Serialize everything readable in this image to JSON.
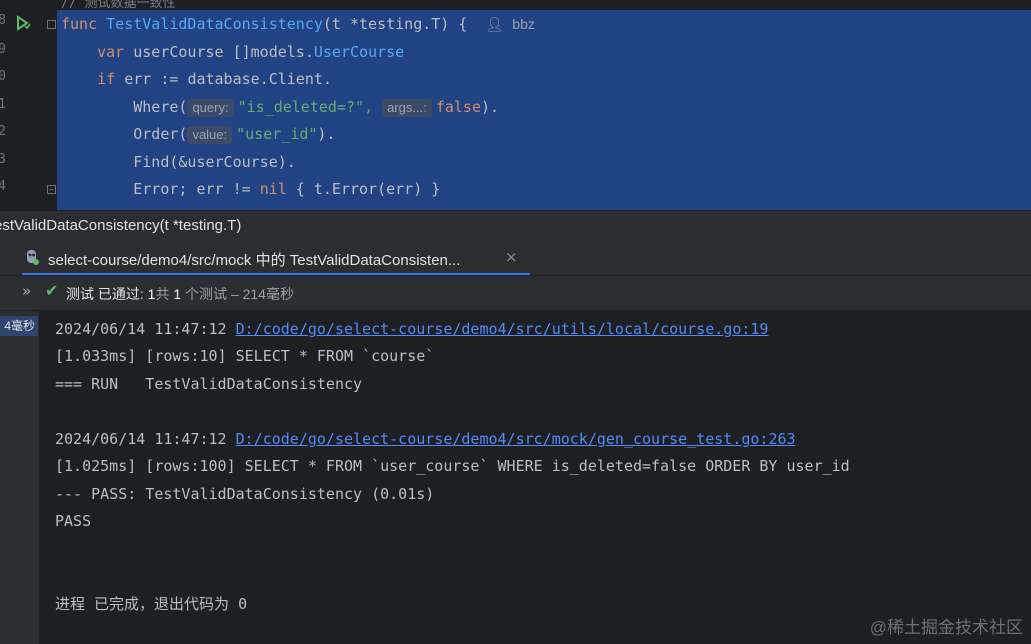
{
  "editor": {
    "comment": "// 测试数据一致性",
    "line_numbers": [
      "8",
      "9",
      "0",
      "1",
      "2",
      "3",
      "4"
    ],
    "lines": {
      "l1": {
        "kw": "func",
        "fn": "TestValidDataConsistency",
        "params": "(t *testing.T) {",
        "author_icon": "user-icon",
        "author": "bbz"
      },
      "l2": {
        "kw": "var",
        "name": "userCourse",
        "slice": "[]models.",
        "type": "UserCourse"
      },
      "l3": {
        "kw": "if",
        "expr": "err := ",
        "db": "database",
        "rest": ".Client."
      },
      "l4": {
        "method": "Where(",
        "hint1": "query:",
        "arg1": "\"is_deleted=?\",",
        "hint2": "args...:",
        "arg2": "false",
        "end": ")."
      },
      "l5": {
        "method": "Order(",
        "hint": "value:",
        "arg": "\"user_id\"",
        "end": ")."
      },
      "l6": {
        "text": "Find(&userCourse)."
      },
      "l7": {
        "text1": "Error; err != ",
        "kw": "nil",
        "text2": " { t.Error(err) }"
      }
    }
  },
  "breadcrumb": {
    "text": "estValidDataConsistency(t *testing.T)"
  },
  "run_tab": {
    "label": "select-course/demo4/src/mock 中的 TestValidDataConsisten...",
    "close": "×"
  },
  "status": {
    "expand": "»",
    "check": "✔",
    "part1": "测试 已通过: ",
    "passed": "1",
    "part2": "共 ",
    "total": "1",
    "part3": " 个测试 – 214毫秒"
  },
  "tree": {
    "time_badge": "4毫秒"
  },
  "console": {
    "line1_time": "2024/06/14 11:47:12 ",
    "line1_link": "D:/code/go/select-course/demo4/src/utils/local/course.go:19",
    "line2": "[1.033ms] [rows:10] SELECT * FROM `course`",
    "line3": "=== RUN   TestValidDataConsistency",
    "line4_time": "2024/06/14 11:47:12 ",
    "line4_link": "D:/code/go/select-course/demo4/src/mock/gen_course_test.go:263",
    "line5": "[1.025ms] [rows:100] SELECT * FROM `user_course` WHERE is_deleted=false ORDER BY user_id",
    "line6": "--- PASS: TestValidDataConsistency (0.01s)",
    "line7": "PASS",
    "line8": "进程 已完成，退出代码为 0"
  },
  "watermark": "@稀土掘金技术社区",
  "colors": {
    "selection": "#214283",
    "accent": "#3574f0",
    "pass_green": "#5fb865",
    "link": "#548af7"
  }
}
